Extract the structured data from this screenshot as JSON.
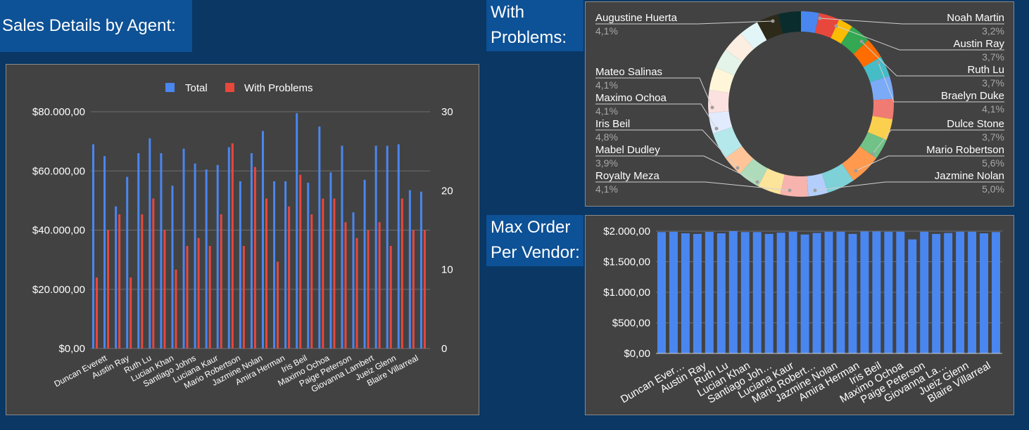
{
  "titles": {
    "sales": "Sales Details by Agent:",
    "problems_line1": "With",
    "problems_line2": "Problems:",
    "maxorder_line1": "Max Order",
    "maxorder_line2": "Per Vendor:"
  },
  "colors": {
    "background": "#0a3764",
    "title_box": "#0d5196",
    "panel": "#424242",
    "total": "#4a86f0",
    "with_problems": "#e8473c",
    "max_order": "#4a86f0"
  },
  "chart_data": [
    {
      "type": "bar",
      "id": "sales-details",
      "legend": {
        "position": "top",
        "labels": [
          "Total",
          "With Problems"
        ]
      },
      "categories_shown": [
        "Duncan Everett",
        "Austin Ray",
        "Ruth Lu",
        "Lucian Khan",
        "Santiago Johns",
        "Luciana Kaur",
        "Mario Robertson",
        "Jazmine Nolan",
        "Amira Herman",
        "Iris Beil",
        "Maximo Ochoa",
        "Paige Peterson",
        "Giovanna Lambert",
        "Jueiz Glenn",
        "Blaire Villarreal"
      ],
      "left_axis": {
        "ticks": [
          "$0,00",
          "$20.000,00",
          "$40.000,00",
          "$60.000,00",
          "$80.000,00"
        ],
        "range": [
          0,
          80000
        ]
      },
      "right_axis": {
        "ticks": [
          "0",
          "10",
          "20",
          "30"
        ],
        "range": [
          0,
          30
        ]
      },
      "series": [
        {
          "name": "Total",
          "axis": "left",
          "values": [
            69000,
            65000,
            48000,
            58000,
            66000,
            71000,
            66000,
            55000,
            67500,
            62500,
            60500,
            62000,
            68000,
            56500,
            66000,
            73500,
            56500,
            56500,
            79500,
            56000,
            75000,
            59500,
            68500,
            46000,
            57000,
            68500,
            68500,
            69000,
            53500,
            53000
          ]
        },
        {
          "name": "With Problems",
          "axis": "right",
          "values": [
            9,
            15,
            17,
            9,
            17,
            19,
            15,
            10,
            13,
            14,
            13,
            17,
            26,
            13,
            23,
            19,
            11,
            18,
            22,
            17,
            19,
            19,
            16,
            14,
            15,
            16,
            13,
            19,
            15,
            15
          ]
        }
      ]
    },
    {
      "type": "pie",
      "id": "with-problems",
      "donut": true,
      "labels_shown": [
        {
          "name": "Augustine Huerta",
          "value": "4,1%",
          "side": "left"
        },
        {
          "name": "Mateo Salinas",
          "value": "4,1%",
          "side": "left"
        },
        {
          "name": "Maximo Ochoa",
          "value": "4,1%",
          "side": "left"
        },
        {
          "name": "Iris Beil",
          "value": "4,8%",
          "side": "left"
        },
        {
          "name": "Mabel Dudley",
          "value": "3,9%",
          "side": "left"
        },
        {
          "name": "Royalty Meza",
          "value": "4,1%",
          "side": "left"
        },
        {
          "name": "Noah Martin",
          "value": "3,2%",
          "side": "right"
        },
        {
          "name": "Austin Ray",
          "value": "3,7%",
          "side": "right"
        },
        {
          "name": "Ruth Lu",
          "value": "3,7%",
          "side": "right"
        },
        {
          "name": "Braelyn Duke",
          "value": "4,1%",
          "side": "right"
        },
        {
          "name": "Dulce Stone",
          "value": "3,7%",
          "side": "right"
        },
        {
          "name": "Mario Robertson",
          "value": "5,6%",
          "side": "right"
        },
        {
          "name": "Jazmine Nolan",
          "value": "5,0%",
          "side": "right"
        }
      ],
      "slices": [
        3.2,
        3.7,
        2.6,
        3.7,
        3.7,
        3.7,
        4.1,
        3.6,
        3.8,
        3.7,
        5.6,
        5.0,
        3.5,
        5.0,
        4.1,
        3.9,
        3.8,
        4.8,
        3.7,
        4.1,
        4.1,
        3.6,
        3.9,
        3.5,
        3.9,
        4.1
      ],
      "slice_colors": [
        "#4a86f0",
        "#e8473c",
        "#fbbc04",
        "#34a853",
        "#ff6d00",
        "#46bdc6",
        "#7baaf7",
        "#f07b72",
        "#fcd04f",
        "#71c287",
        "#ff994d",
        "#7ed1d7",
        "#b3cefb",
        "#f7b4ae",
        "#fde49b",
        "#aedcba",
        "#ffc599",
        "#b5e8eb",
        "#e1ebfd",
        "#fbe1df",
        "#fff6d9",
        "#e4f4e8",
        "#fdeee2",
        "#e3f6f7",
        "#2d2a1a",
        "#0b2c2c",
        "#0a1a3e",
        "#2a1a2a",
        "#f0213a"
      ]
    },
    {
      "type": "bar",
      "id": "max-order",
      "categories_shown": [
        "Duncan Ever…",
        "Austin Ray",
        "Ruth Lu",
        "Lucian Khan",
        "Santiago Joh…",
        "Luciana Kaur",
        "Mario Robert…",
        "Jazmine Nolan",
        "Amira Herman",
        "Iris Beil",
        "Maximo Ochoa",
        "Paige Peterson",
        "Giovanna La…",
        "Jueiz Glenn",
        "Blaire Villarreal"
      ],
      "y_axis": {
        "ticks": [
          "$0,00",
          "$500,00",
          "$1.000,00",
          "$1.500,00",
          "$2.000,00"
        ],
        "range": [
          0,
          2000
        ]
      },
      "values": [
        1985,
        1990,
        1965,
        1955,
        1988,
        1965,
        2000,
        1985,
        1985,
        1955,
        1975,
        1990,
        1945,
        1970,
        1990,
        1990,
        1955,
        1995,
        1995,
        1990,
        1990,
        1865,
        1990,
        1955,
        1970,
        1990,
        1990,
        1965,
        1985
      ]
    }
  ]
}
